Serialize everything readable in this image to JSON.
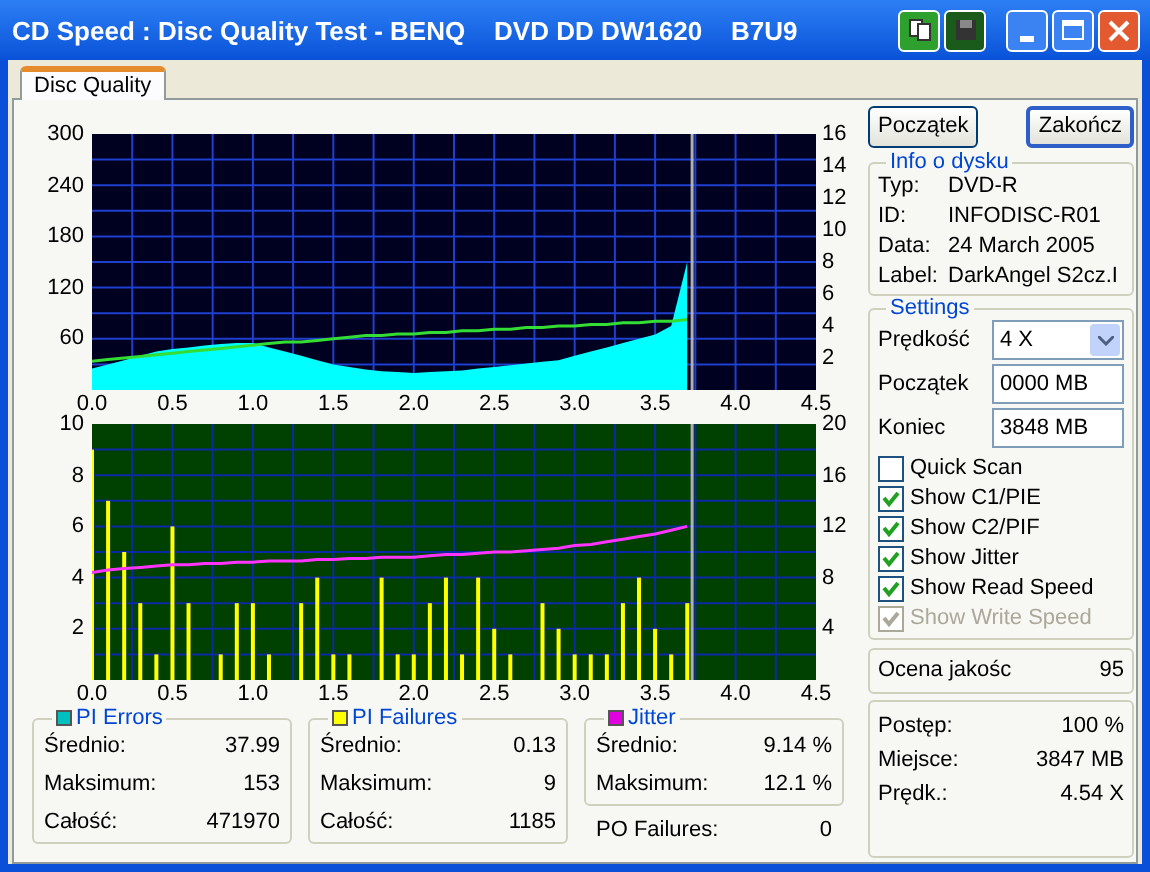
{
  "window": {
    "title": "CD Speed : Disc Quality Test - BENQ    DVD DD DW1620    B7U9"
  },
  "tabs": [
    {
      "label": "Disc Quality",
      "selected": true
    }
  ],
  "charts": [
    {
      "chart_data": {
        "type": "area",
        "xlim": [
          0,
          4.5
        ],
        "ylim": [
          0,
          300
        ],
        "y2lim": [
          0,
          16
        ],
        "xticks": [
          {
            "value": 0,
            "label": "0.0"
          },
          {
            "value": 0.5,
            "label": "0.5"
          },
          {
            "value": 1,
            "label": "1.0"
          },
          {
            "value": 1.5,
            "label": "1.5"
          },
          {
            "value": 2,
            "label": "2.0"
          },
          {
            "value": 2.5,
            "label": "2.5"
          },
          {
            "value": 3,
            "label": "3.0"
          },
          {
            "value": 3.5,
            "label": "3.5"
          },
          {
            "value": 4,
            "label": "4.0"
          },
          {
            "value": 4.5,
            "label": "4.5"
          }
        ],
        "yticks": [
          60,
          120,
          180,
          240,
          300
        ],
        "y2ticks": [
          2,
          4,
          6,
          8,
          10,
          12,
          14,
          16
        ],
        "x": [
          0,
          0.1,
          0.2,
          0.3,
          0.4,
          0.5,
          0.6,
          0.7,
          0.8,
          0.9,
          1,
          1.1,
          1.2,
          1.3,
          1.4,
          1.5,
          1.6,
          1.7,
          1.8,
          1.9,
          2,
          2.1,
          2.2,
          2.3,
          2.4,
          2.5,
          2.6,
          2.7,
          2.8,
          2.9,
          3,
          3.1,
          3.2,
          3.3,
          3.4,
          3.5,
          3.6,
          3.7
        ],
        "series": [
          {
            "color": "#00ffff",
            "values": [
              25,
              30,
              35,
              40,
              45,
              48,
              50,
              52,
              54,
              55,
              55,
              50,
              45,
              40,
              35,
              30,
              27,
              24,
              22,
              21,
              20,
              21,
              22,
              23,
              25,
              27,
              29,
              31,
              33,
              35,
              40,
              45,
              50,
              55,
              60,
              65,
              75,
              150
            ]
          },
          {
            "axis": "y2",
            "type": "line",
            "color": "#33dd33",
            "values": [
              1.8,
              1.9,
              2.0,
              2.1,
              2.2,
              2.3,
              2.4,
              2.5,
              2.6,
              2.7,
              2.8,
              2.9,
              3.0,
              3.0,
              3.1,
              3.2,
              3.3,
              3.4,
              3.4,
              3.5,
              3.5,
              3.6,
              3.6,
              3.7,
              3.7,
              3.8,
              3.8,
              3.9,
              3.9,
              4.0,
              4.0,
              4.1,
              4.1,
              4.2,
              4.2,
              4.3,
              4.3,
              4.4
            ]
          }
        ],
        "grid": true,
        "ref_lines": [
          {
            "axis": "x",
            "value": 3.73,
            "color": "#b0b0b0"
          }
        ]
      }
    },
    {
      "chart_data": {
        "type": "bar",
        "xlim": [
          0,
          4.5
        ],
        "ylim": [
          0,
          10
        ],
        "y2lim": [
          0,
          20
        ],
        "xticks": [
          {
            "value": 0,
            "label": "0.0"
          },
          {
            "value": 0.5,
            "label": "0.5"
          },
          {
            "value": 1,
            "label": "1.0"
          },
          {
            "value": 1.5,
            "label": "1.5"
          },
          {
            "value": 2,
            "label": "2.0"
          },
          {
            "value": 2.5,
            "label": "2.5"
          },
          {
            "value": 3,
            "label": "3.0"
          },
          {
            "value": 3.5,
            "label": "3.5"
          },
          {
            "value": 4,
            "label": "4.0"
          },
          {
            "value": 4.5,
            "label": "4.5"
          }
        ],
        "yticks": [
          2,
          4,
          6,
          8,
          10
        ],
        "y2ticks": [
          4,
          8,
          12,
          16,
          20
        ],
        "x": [
          0,
          0.1,
          0.2,
          0.3,
          0.4,
          0.5,
          0.6,
          0.7,
          0.8,
          0.9,
          1,
          1.1,
          1.2,
          1.3,
          1.4,
          1.5,
          1.6,
          1.7,
          1.8,
          1.9,
          2,
          2.1,
          2.2,
          2.3,
          2.4,
          2.5,
          2.6,
          2.7,
          2.8,
          2.9,
          3,
          3.1,
          3.2,
          3.3,
          3.4,
          3.5,
          3.6,
          3.7
        ],
        "series": [
          {
            "color": "#ffff00",
            "values": [
              9,
              7,
              5,
              3,
              1,
              6,
              3,
              0,
              1,
              3,
              3,
              1,
              0,
              3,
              4,
              1,
              1,
              0,
              4,
              1,
              1,
              3,
              4,
              1,
              4,
              2,
              1,
              0,
              3,
              2,
              1,
              1,
              1,
              3,
              4,
              2,
              1,
              3
            ]
          },
          {
            "axis": "y2",
            "type": "line",
            "color": "#ff33ff",
            "values": [
              8.4,
              8.6,
              8.7,
              8.8,
              8.9,
              9.0,
              9.0,
              9.1,
              9.1,
              9.2,
              9.2,
              9.3,
              9.3,
              9.3,
              9.4,
              9.4,
              9.5,
              9.5,
              9.6,
              9.6,
              9.6,
              9.7,
              9.8,
              9.8,
              9.9,
              10.0,
              10.0,
              10.1,
              10.2,
              10.3,
              10.5,
              10.6,
              10.8,
              11.0,
              11.2,
              11.4,
              11.7,
              12.0
            ]
          }
        ],
        "grid": true,
        "ref_lines": [
          {
            "axis": "x",
            "value": 3.73,
            "color": "#b0b0b0"
          }
        ]
      }
    }
  ],
  "stats": [
    {
      "title": "PI Errors",
      "color": "#00c0c0",
      "rows": [
        {
          "label": "Średnio:",
          "value": "37.99"
        },
        {
          "label": "Maksimum:",
          "value": "153"
        },
        {
          "label": "Całość:",
          "value": "471970"
        }
      ]
    },
    {
      "title": "PI Failures",
      "color": "#ffff00",
      "rows": [
        {
          "label": "Średnio:",
          "value": "0.13"
        },
        {
          "label": "Maksimum:",
          "value": "9"
        },
        {
          "label": "Całość:",
          "value": "1185"
        }
      ]
    },
    {
      "title": "Jitter",
      "color": "#e000e0",
      "rows": [
        {
          "label": "Średnio:",
          "value": "9.14 %"
        },
        {
          "label": "Maksimum:",
          "value": "12.1 %"
        }
      ]
    }
  ],
  "po_failures": {
    "label": "PO Failures:",
    "value": "0"
  },
  "buttons": [
    {
      "label": "Początek",
      "default": false
    },
    {
      "label": "Zakończ",
      "default": true
    }
  ],
  "disc_info": {
    "title": "Info o dysku",
    "rows": [
      {
        "label": "Typ:",
        "value": "DVD-R"
      },
      {
        "label": "ID:",
        "value": "INFODISC-R01"
      },
      {
        "label": "Data:",
        "value": "24 March 2005"
      },
      {
        "label": "Label:",
        "value": "DarkAngel S2cz.I"
      }
    ]
  },
  "settings": {
    "title": "Settings",
    "speed": {
      "label": "Prędkość",
      "value": "4 X"
    },
    "fields": [
      {
        "label": "Początek",
        "value": "0000 MB"
      },
      {
        "label": "Koniec",
        "value": "3848 MB"
      }
    ],
    "checkboxes": [
      {
        "label": "Quick Scan",
        "checked": false,
        "disabled": false
      },
      {
        "label": "Show C1/PIE",
        "checked": true,
        "disabled": false
      },
      {
        "label": "Show C2/PIF",
        "checked": true,
        "disabled": false
      },
      {
        "label": "Show Jitter",
        "checked": true,
        "disabled": false
      },
      {
        "label": "Show Read Speed",
        "checked": true,
        "disabled": false
      },
      {
        "label": "Show Write Speed",
        "checked": true,
        "disabled": true
      }
    ]
  },
  "quality": {
    "label": "Ocena jakośc",
    "value": "95"
  },
  "progress": [
    {
      "label": "Postęp:",
      "value": "100 %"
    },
    {
      "label": "Miejsce:",
      "value": "3847 MB"
    },
    {
      "label": "Prędk.:",
      "value": "4.54 X"
    }
  ]
}
